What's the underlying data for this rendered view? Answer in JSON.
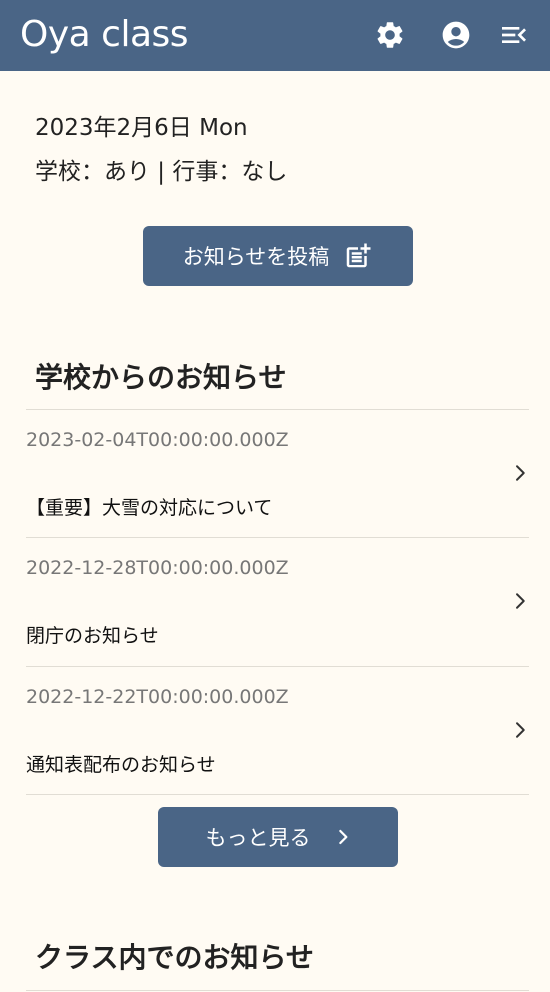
{
  "header": {
    "title": "Oya class",
    "icons": [
      "gear-icon",
      "account-circle-icon",
      "menu-collapse-icon"
    ],
    "background": "#4a6586"
  },
  "today": {
    "date": "2023年2月6日 Mon",
    "status": "学校：あり | 行事：なし"
  },
  "post_button": {
    "label": "お知らせを投稿",
    "icon": "post-add-icon"
  },
  "school_notices": {
    "title": "学校からのお知らせ",
    "items": [
      {
        "date": "2023-02-04T00:00:00.000Z",
        "title": "【重要】大雪の対応について"
      },
      {
        "date": "2022-12-28T00:00:00.000Z",
        "title": "閉庁のお知らせ"
      },
      {
        "date": "2022-12-22T00:00:00.000Z",
        "title": "通知表配布のお知らせ"
      }
    ]
  },
  "more_button": {
    "label": "もっと見る",
    "icon": "chevron-right-icon"
  },
  "class_notices": {
    "title": "クラス内でのお知らせ"
  },
  "colors": {
    "accent": "#4a6586",
    "background": "#fffbf3",
    "divider": "#e1ddd4",
    "muted_text": "#777777"
  }
}
